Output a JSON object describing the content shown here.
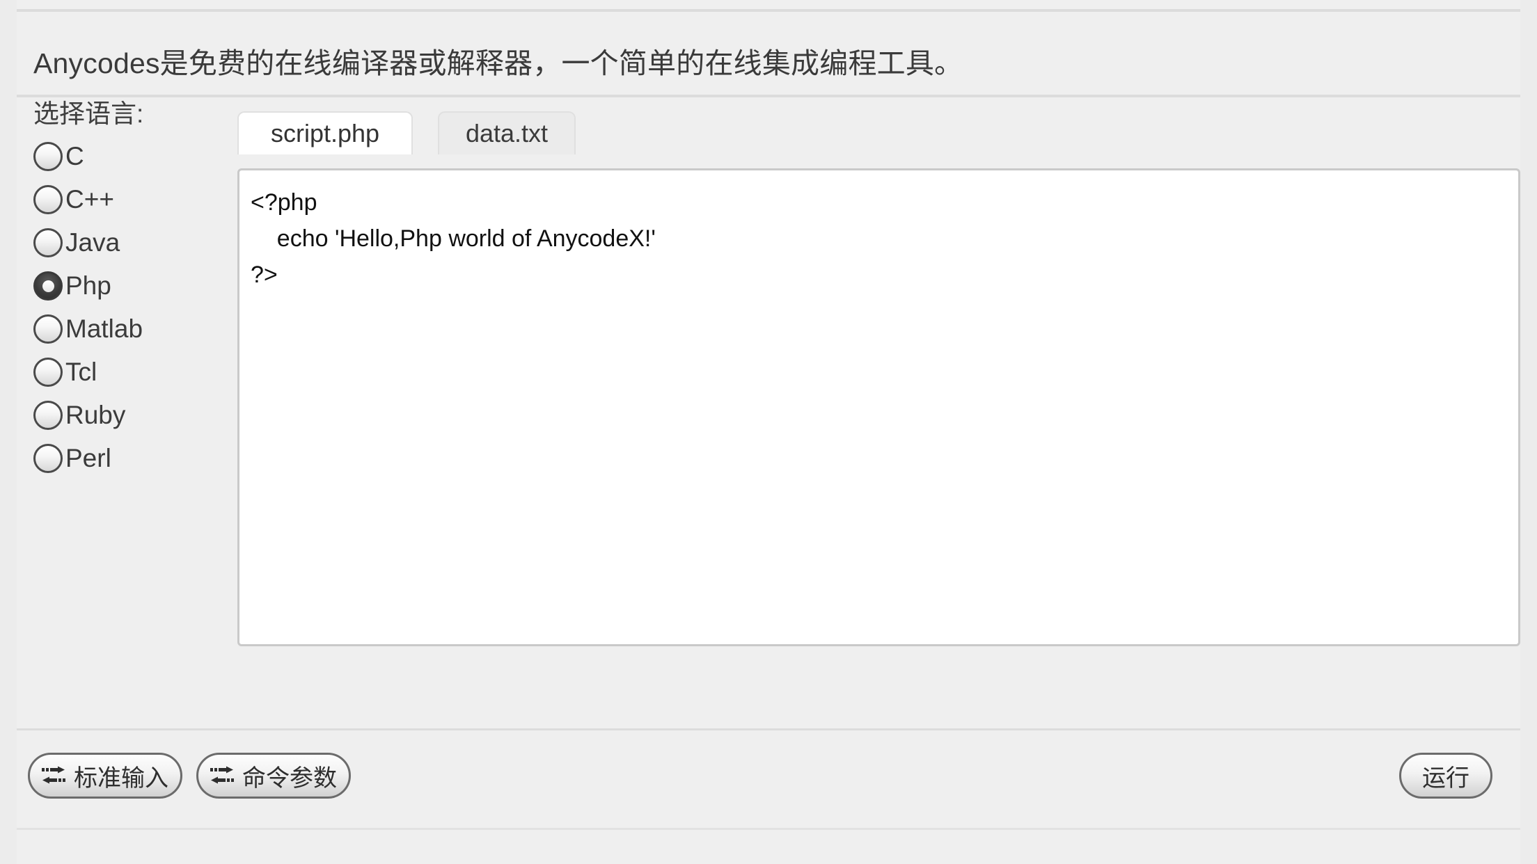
{
  "header": {
    "title": "Anycodes是免费的在线编译器或解释器，一个简单的在线集成编程工具。"
  },
  "sidebar": {
    "label": "选择语言:",
    "selected": "Php",
    "items": [
      {
        "label": "C",
        "checked": false
      },
      {
        "label": "C++",
        "checked": false
      },
      {
        "label": "Java",
        "checked": false
      },
      {
        "label": "Php",
        "checked": true
      },
      {
        "label": "Matlab",
        "checked": false
      },
      {
        "label": "Tcl",
        "checked": false
      },
      {
        "label": "Ruby",
        "checked": false
      },
      {
        "label": "Perl",
        "checked": false
      }
    ]
  },
  "editor": {
    "tabs": [
      {
        "label": "script.php",
        "active": true
      },
      {
        "label": "data.txt",
        "active": false
      }
    ],
    "active_tab": "script.php",
    "code": "<?php\n    echo 'Hello,Php world of AnycodeX!'\n?>"
  },
  "toolbar": {
    "stdin_label": "标准输入",
    "args_label": "命令参数",
    "run_label": "运行",
    "stdin_icon": "transfer-icon",
    "args_icon": "transfer-icon"
  },
  "colors": {
    "page_background": "#ececec",
    "panel_background": "#efefef",
    "editor_background": "#ffffff",
    "divider": "#dcdcdc",
    "text": "#3b3b3b",
    "button_border": "#6b6b6b"
  }
}
